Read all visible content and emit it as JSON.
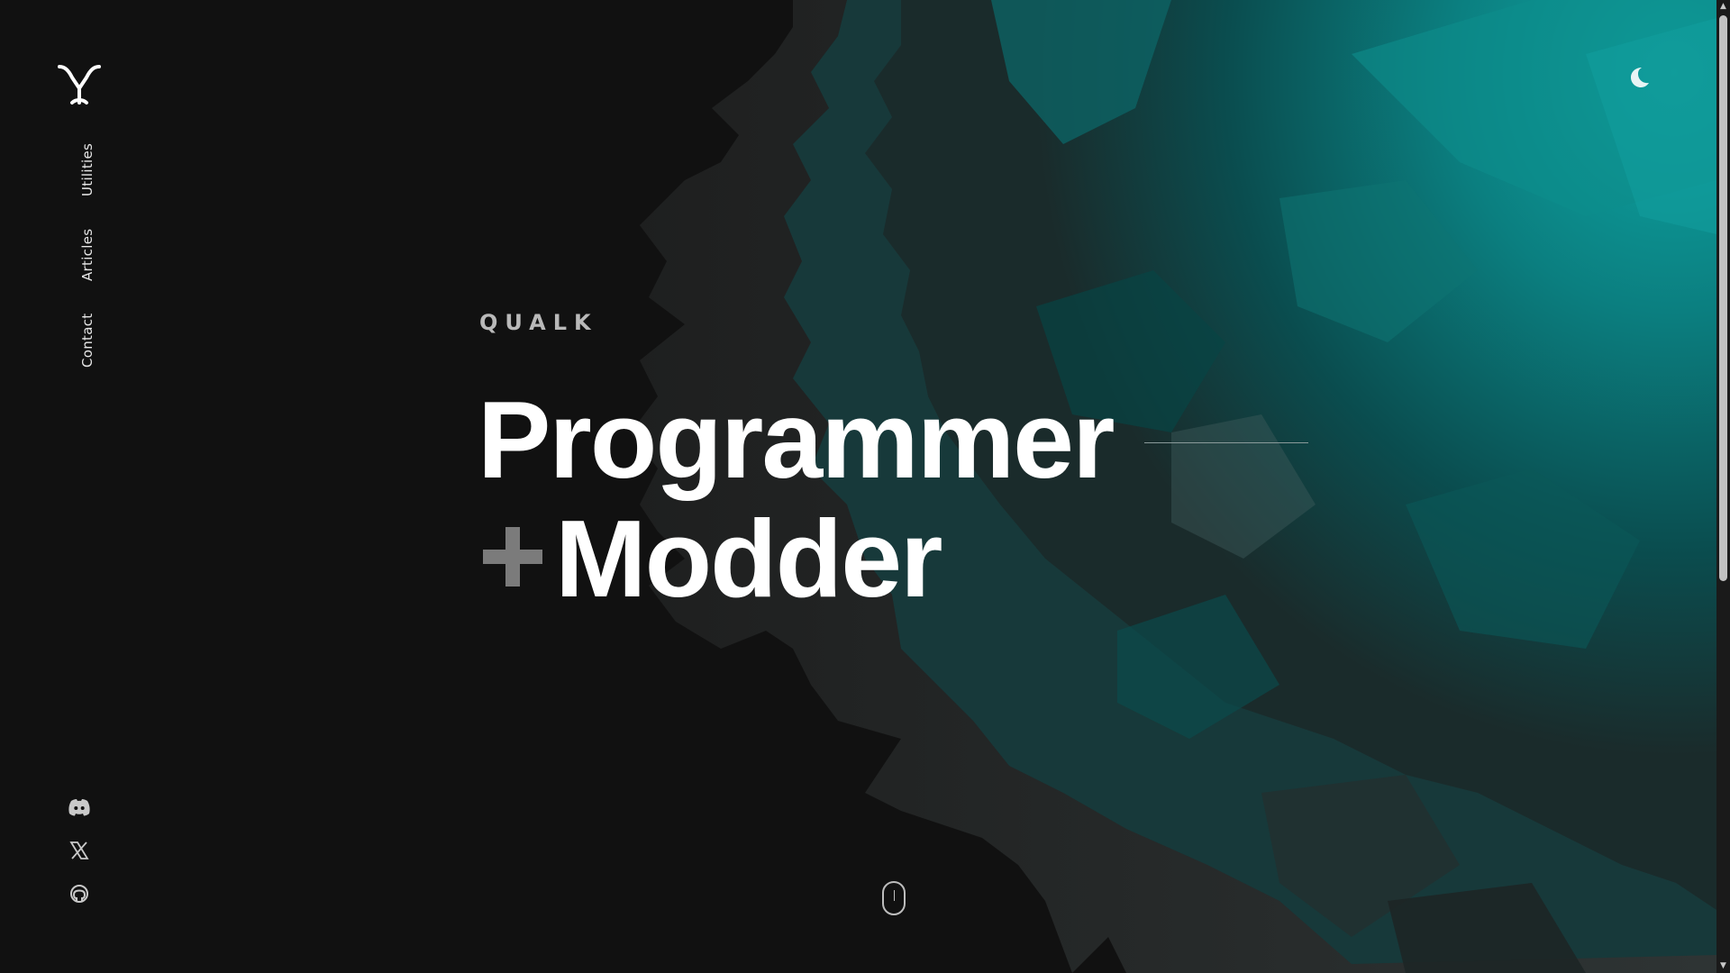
{
  "nav": {
    "items": [
      {
        "label": "Utilities"
      },
      {
        "label": "Articles"
      },
      {
        "label": "Contact"
      }
    ]
  },
  "hero": {
    "kicker": "QUALK",
    "line1": "Programmer",
    "line2": "Modder"
  },
  "icons": {
    "logo": "y-logo-icon",
    "theme_toggle": "moon-icon",
    "social": [
      "discord-icon",
      "x-icon",
      "github-icon"
    ],
    "scroll_hint": "mouse-icon"
  },
  "colors": {
    "background": "#111111",
    "accent_teal": "#0f9b9b",
    "text": "#ffffff",
    "muted": "#b9b9b9"
  }
}
